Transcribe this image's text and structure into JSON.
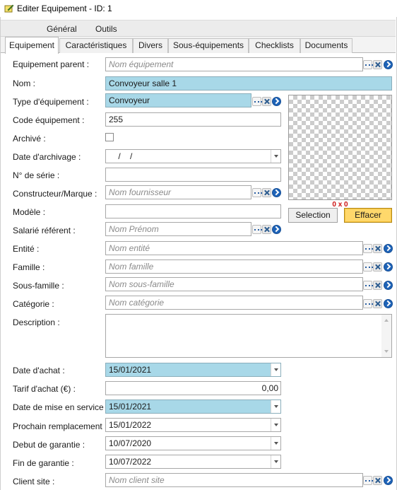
{
  "window": {
    "title": "Editer Equipement - ID: 1"
  },
  "menu": [
    "Général",
    "Outils"
  ],
  "tabs": [
    "Equipement",
    "Caractéristiques",
    "Divers",
    "Sous-équipements",
    "Checklists",
    "Documents"
  ],
  "form": {
    "equipement_parent": {
      "label": "Equipement parent :",
      "placeholder": "Nom équipement"
    },
    "nom": {
      "label": "Nom :",
      "value": "Convoyeur salle 1"
    },
    "type": {
      "label": "Type d'équipement :",
      "value": "Convoyeur"
    },
    "code": {
      "label": "Code équipement :",
      "value": "255"
    },
    "archive": {
      "label": "Archivé :",
      "checked": false
    },
    "date_archivage": {
      "label": "Date d'archivage :",
      "value": "    /    /"
    },
    "num_serie": {
      "label": "N° de série :",
      "value": ""
    },
    "constructeur": {
      "label": "Constructeur/Marque :",
      "placeholder": "Nom fournisseur"
    },
    "modele": {
      "label": "Modèle :",
      "value": ""
    },
    "salarie": {
      "label": "Salarié référent :",
      "placeholder": "Nom Prénom"
    },
    "entite": {
      "label": "Entité :",
      "placeholder": "Nom entité"
    },
    "famille": {
      "label": "Famille :",
      "placeholder": "Nom famille"
    },
    "sous_famille": {
      "label": "Sous-famille :",
      "placeholder": "Nom sous-famille"
    },
    "categorie": {
      "label": "Catégorie :",
      "placeholder": "Nom catégorie"
    },
    "description": {
      "label": "Description :",
      "value": ""
    },
    "date_achat": {
      "label": "Date d'achat :",
      "value": "15/01/2021"
    },
    "tarif_achat": {
      "label": "Tarif d'achat (€) :",
      "value": "0,00"
    },
    "date_mise_service": {
      "label": "Date de mise en service :",
      "value": "15/01/2021"
    },
    "prochain_remplacement": {
      "label": "Prochain remplacement :",
      "value": "15/01/2022"
    },
    "debut_garantie": {
      "label": "Debut de garantie :",
      "value": "10/07/2020"
    },
    "fin_garantie": {
      "label": "Fin de garantie :",
      "value": "10/07/2022"
    },
    "client_site": {
      "label": "Client site :",
      "placeholder": "Nom client site"
    }
  },
  "image_panel": {
    "size_text": "0 x 0",
    "selection_label": "Selection",
    "effacer_label": "Effacer"
  },
  "colors": {
    "highlight_field": "#a8d8e8",
    "effacer_button": "#ffd86b",
    "size_text": "#cc1111",
    "action_blue": "#1e63b8"
  },
  "icons": [
    "edit-note-icon",
    "ellipsis-icon",
    "clear-x-icon",
    "go-arrow-icon",
    "dropdown-arrow-icon"
  ]
}
